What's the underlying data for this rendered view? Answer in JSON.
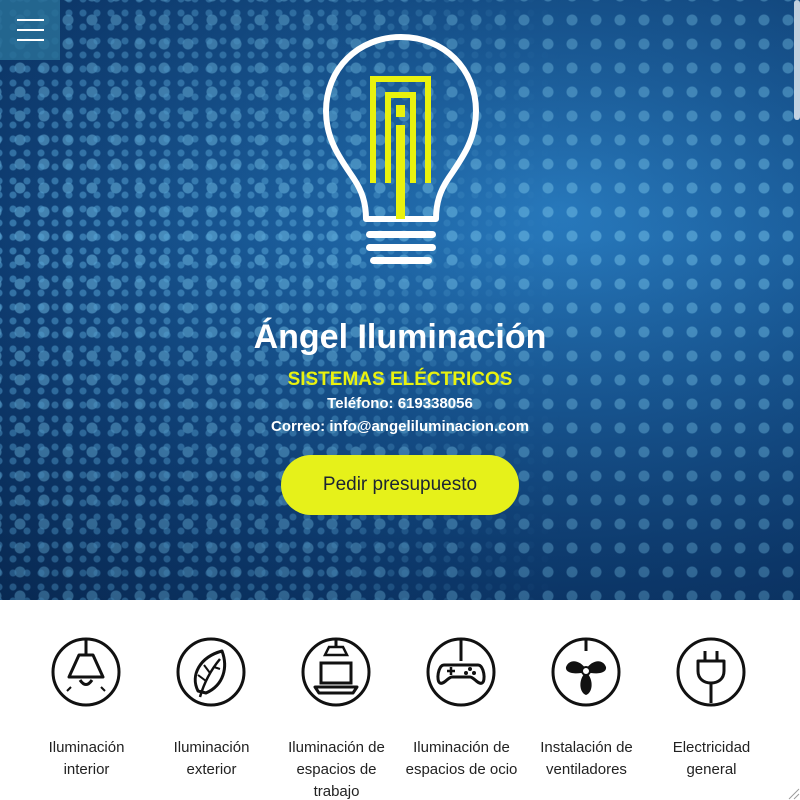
{
  "header": {
    "menu_icon": "hamburger-menu-icon"
  },
  "hero": {
    "logo_icon": "lightbulb-logo-icon",
    "title": "Ángel Iluminación",
    "subtitle": "SISTEMAS ELÉCTRICOS",
    "phone": "Teléfono: 619338056",
    "email": "Correo: info@angeliluminacion.com",
    "cta_label": "Pedir presupuesto"
  },
  "colors": {
    "accent_yellow": "#e6f11a",
    "hero_blue": "#1b5f9e",
    "text_dark": "#222222"
  },
  "services": [
    {
      "icon": "pendant-lamp-icon",
      "label": "Iluminación interior"
    },
    {
      "icon": "leaf-icon",
      "label": "Iluminación exterior"
    },
    {
      "icon": "laptop-icon",
      "label": "Iluminación de espacios de trabajo"
    },
    {
      "icon": "gamepad-icon",
      "label": "Iluminación de espacios de ocio"
    },
    {
      "icon": "fan-icon",
      "label": "Instalación de ventiladores"
    },
    {
      "icon": "plug-icon",
      "label": "Electricidad general"
    }
  ]
}
